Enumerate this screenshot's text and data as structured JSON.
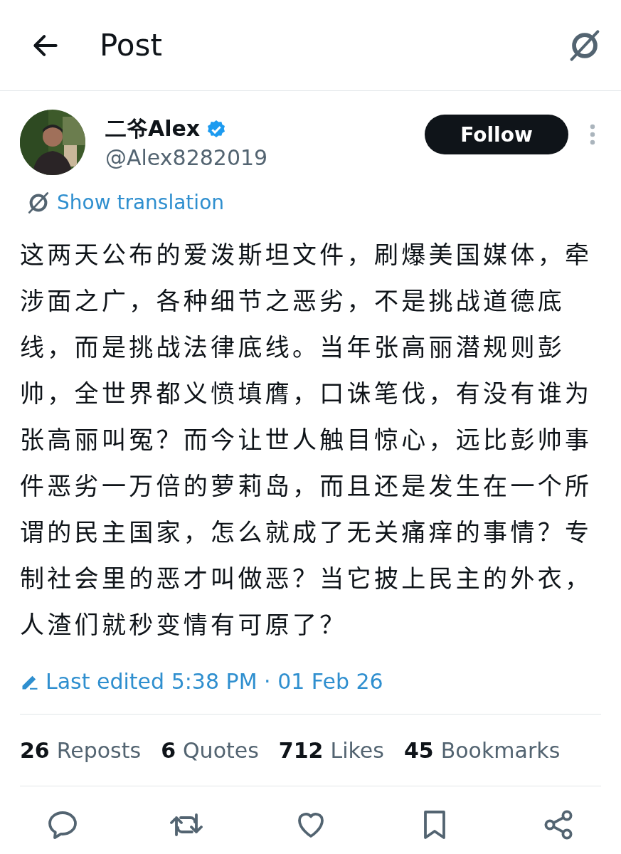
{
  "header": {
    "title": "Post"
  },
  "author": {
    "name": "二爷Alex",
    "verified": true,
    "handle": "@Alex8282019",
    "follow_button": "Follow"
  },
  "translation_link": "Show translation",
  "text": "这两天公布的爱泼斯坦文件，刷爆美国媒体，牵涉面之广，各种细节之恶劣，不是挑战道德底线，而是挑战法律底线。当年张高丽潜规则彭帅，全世界都义愤填膺，口诛笔伐，有没有谁为张高丽叫冤？而今让世人触目惊心，远比彭帅事件恶劣一万倍的萝莉岛，而且还是发生在一个所谓的民主国家，怎么就成了无关痛痒的事情？专制社会里的恶才叫做恶？当它披上民主的外衣，人渣们就秒变情有可原了？",
  "edited": "Last edited 5:38 PM · 01 Feb 26",
  "stats": [
    {
      "count": "26",
      "label": "Reposts"
    },
    {
      "count": "6",
      "label": "Quotes"
    },
    {
      "count": "712",
      "label": "Likes"
    },
    {
      "count": "45",
      "label": "Bookmarks"
    }
  ],
  "actions": [
    {
      "kind": "reply"
    },
    {
      "kind": "repost"
    },
    {
      "kind": "like"
    },
    {
      "kind": "bookmark"
    },
    {
      "kind": "share"
    }
  ]
}
